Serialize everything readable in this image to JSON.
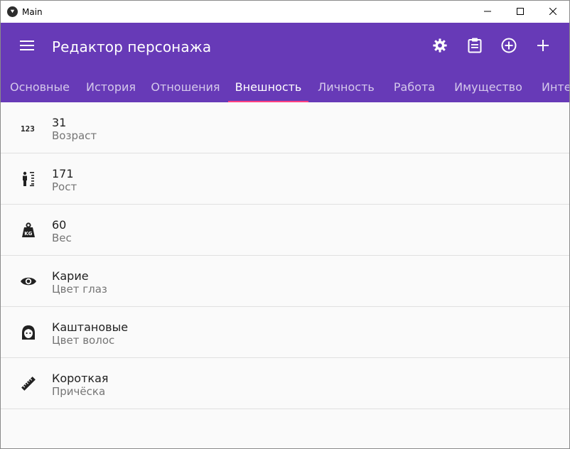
{
  "window": {
    "title": "Main",
    "controls": [
      "minimize-icon",
      "maximize-icon",
      "close-icon"
    ]
  },
  "appbar": {
    "title": "Редактор персонажа",
    "menu_icon": "menu-icon",
    "actions": [
      "settings-icon",
      "clipboard-icon",
      "add-circle-icon",
      "add-icon"
    ]
  },
  "tabs": [
    {
      "label": "Основные"
    },
    {
      "label": "История"
    },
    {
      "label": "Отношения"
    },
    {
      "label": "Внешность",
      "active": true
    },
    {
      "label": "Личность"
    },
    {
      "label": "Работа"
    },
    {
      "label": "Имущество"
    },
    {
      "label": "Интер"
    }
  ],
  "items": [
    {
      "value": "31",
      "label": "Возраст",
      "icon": "numeric-icon"
    },
    {
      "value": "171",
      "label": "Рост",
      "icon": "human-height-icon"
    },
    {
      "value": "60",
      "label": "Вес",
      "icon": "weight-kg-icon"
    },
    {
      "value": "Карие",
      "label": "Цвет глаз",
      "icon": "eye-icon"
    },
    {
      "value": "Каштановые",
      "label": "Цвет волос",
      "icon": "face-woman-icon"
    },
    {
      "value": "Короткая",
      "label": "Причёска",
      "icon": "ruler-icon"
    }
  ],
  "colors": {
    "primary": "#673ab7",
    "indicator": "#ff4081"
  }
}
